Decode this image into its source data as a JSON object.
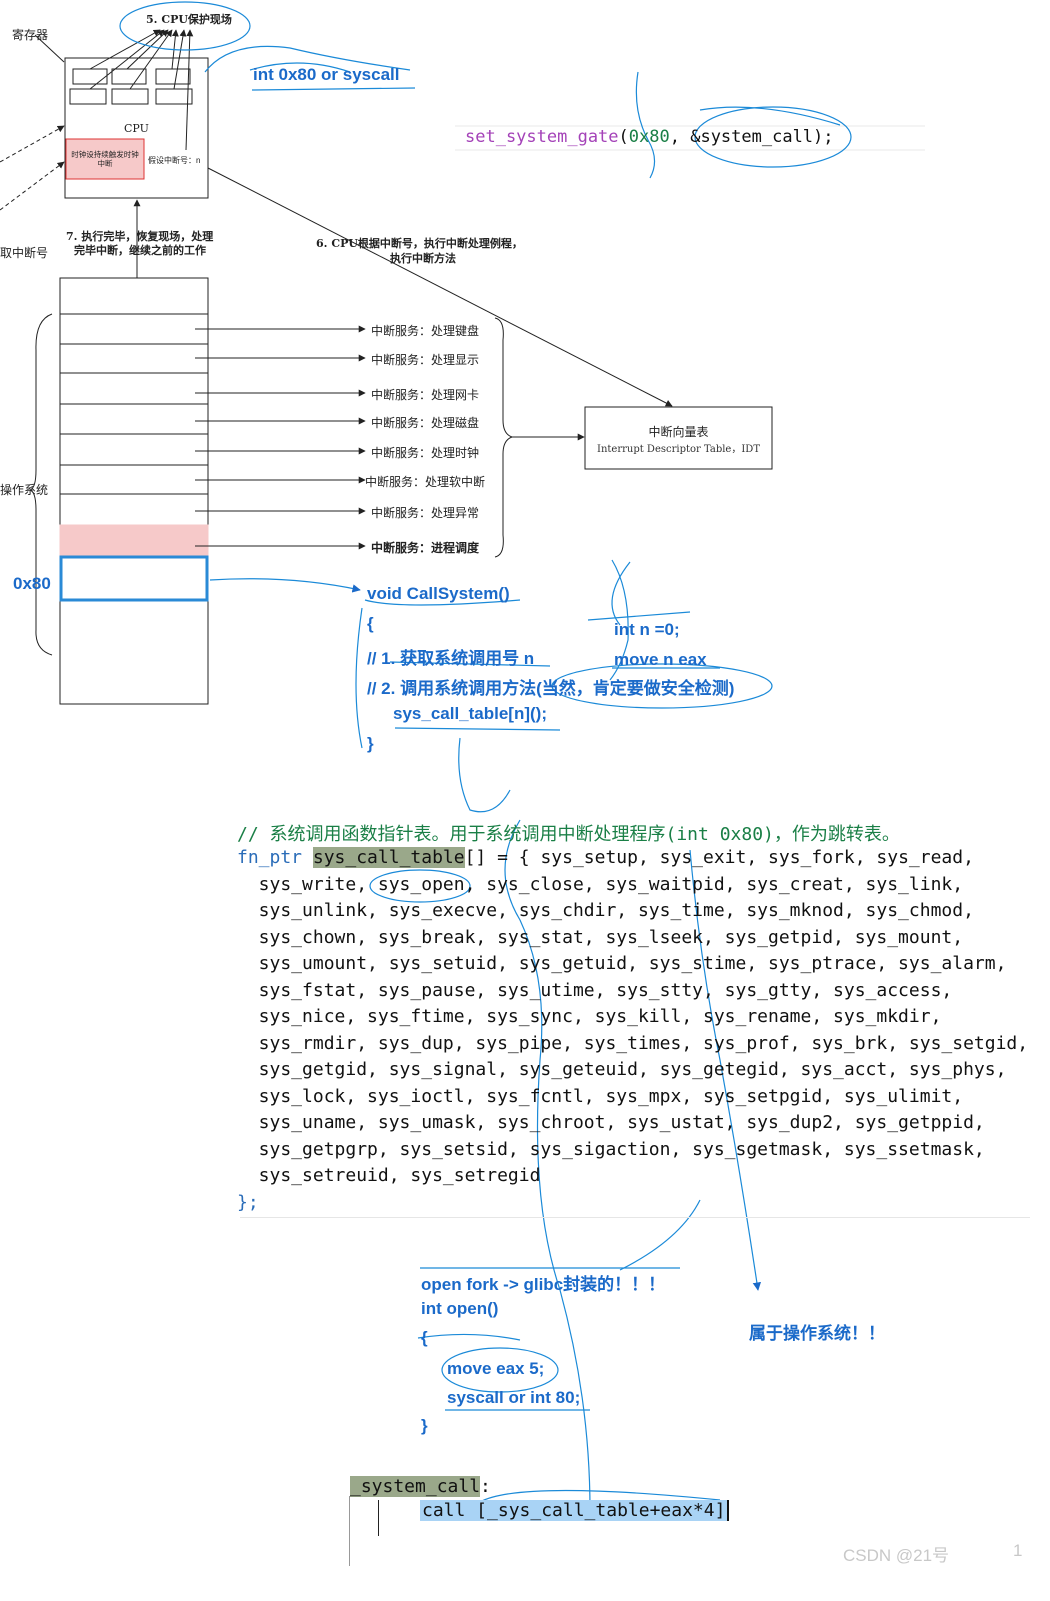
{
  "diagram": {
    "register_label": "寄存器",
    "step5": "5. CPU保护现场",
    "cpu_label": "CPU",
    "clock_box": "时钟设持续触发时钟中断",
    "int_number": "假设中断号：n",
    "int80_syscall": "int 0x80 or syscall",
    "get_int_number": "取中断号",
    "step7_line1": "7. 执行完毕，恢复现场，处理",
    "step7_line2": "完毕中断，继续之前的工作",
    "step6_line1": "6. CPU根据中断号，执行中断处理例程，",
    "step6_line2": "执行中断方法",
    "os_label": "操作系统",
    "hex_label": "0x80",
    "services": [
      "中断服务：处理键盘",
      "中断服务：处理显示",
      "中断服务：处理网卡",
      "中断服务：处理磁盘",
      "中断服务：处理时钟",
      "中断服务：处理软中断",
      "中断服务：处理异常",
      "中断服务：进程调度"
    ],
    "idt_title": "中断向量表",
    "idt_subtitle": "Interrupt Descriptor Table，IDT"
  },
  "gate_code": {
    "fn": "set_system_gate",
    "open": "(",
    "arg1": "0x80",
    "sep": ", ",
    "arg2": "&system_call",
    "close": ");"
  },
  "callsystem": {
    "sig": "void CallSystem()",
    "open": "{",
    "c1": "// 1. 获取系统调用号 n",
    "c2": "// 2. 调用系统调用方法(当然，肯定要做安全检测)",
    "call": "sys_call_table[n]();",
    "close": "}",
    "int_n": "int n =0;",
    "move_n": "move n eax"
  },
  "table_code": {
    "comment": "// 系统调用函数指针表。用于系统调用中断处理程序(int 0x80)，作为跳转表。",
    "type": "fn_ptr",
    "name": "sys_call_table",
    "decl_rest": "[] = { sys_setup, sys_exit, sys_fork, sys_read,",
    "lines": [
      "  sys_write, sys_open, sys_close, sys_waitpid, sys_creat, sys_link,",
      "  sys_unlink, sys_execve, sys_chdir, sys_time, sys_mknod, sys_chmod,",
      "  sys_chown, sys_break, sys_stat, sys_lseek, sys_getpid, sys_mount,",
      "  sys_umount, sys_setuid, sys_getuid, sys_stime, sys_ptrace, sys_alarm,",
      "  sys_fstat, sys_pause, sys_utime, sys_stty, sys_gtty, sys_access,",
      "  sys_nice, sys_ftime, sys_sync, sys_kill, sys_rename, sys_mkdir,",
      "  sys_rmdir, sys_dup, sys_pipe, sys_times, sys_prof, sys_brk, sys_setgid,",
      "  sys_getgid, sys_signal, sys_geteuid, sys_getegid, sys_acct, sys_phys,",
      "  sys_lock, sys_ioctl, sys_fcntl, sys_mpx, sys_setpgid, sys_ulimit,",
      "  sys_uname, sys_umask, sys_chroot, sys_ustat, sys_dup2, sys_getppid,",
      "  sys_getpgrp, sys_setsid, sys_sigaction, sys_sgetmask, sys_ssetmask,",
      "  sys_setreuid, sys_setregid"
    ],
    "end": "};"
  },
  "notes": {
    "glibc": "open fork -> glibc封装的！！！",
    "int_open": "int open()",
    "brace_open": "{",
    "move_eax": "move eax 5;",
    "syscall": "syscall or int 80;",
    "brace_close": "}",
    "belongs_os": "属于操作系统！！"
  },
  "asm": {
    "label": "_system_call",
    "colon": ":",
    "instr": "call [_sys_call_table+eax*4]"
  },
  "watermark": "CSDN @21号",
  "page_num": "1"
}
